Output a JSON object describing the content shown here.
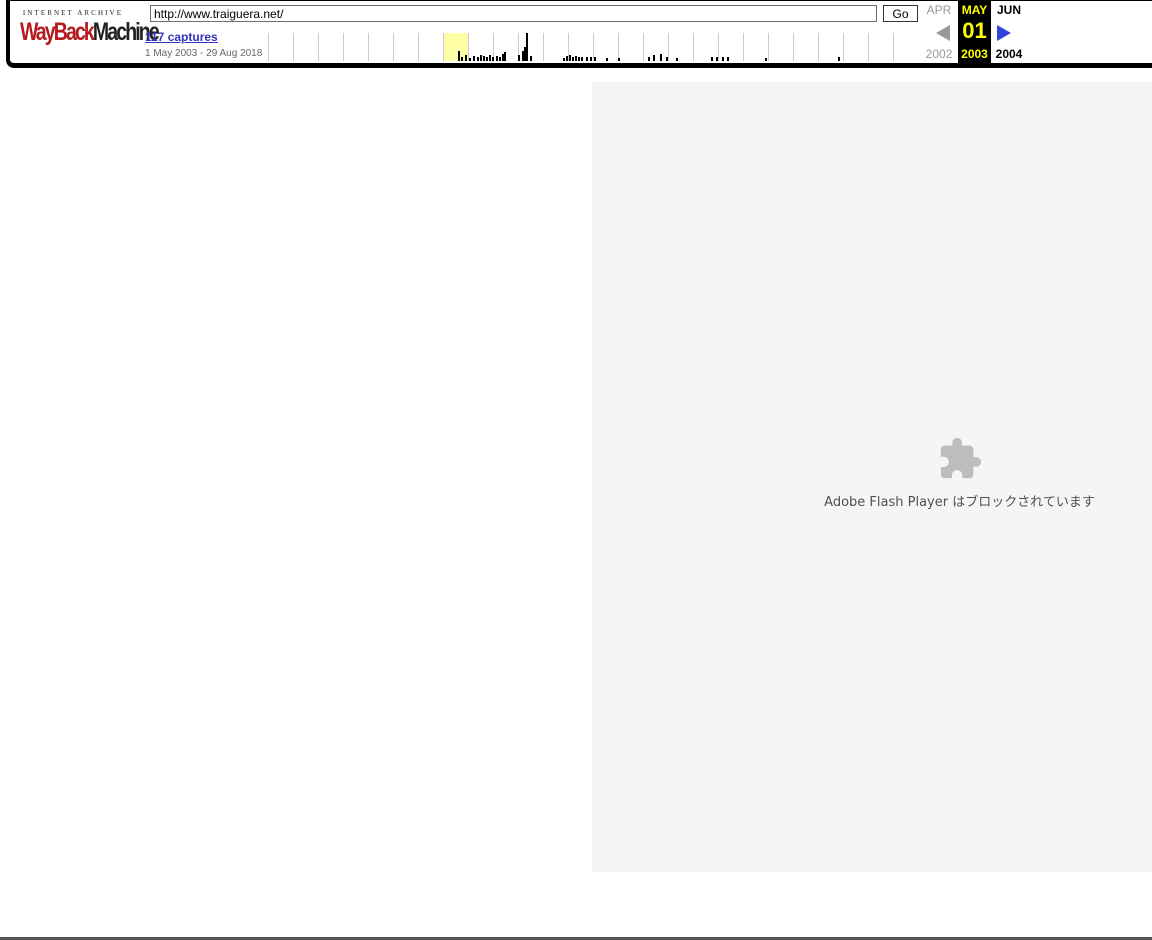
{
  "toolbar": {
    "logo_top": "INTERNET ARCHIVE",
    "logo_wayback": "WayBack",
    "logo_machine": "Machine",
    "url_value": "http://www.traiguera.net/",
    "go_label": "Go",
    "captures_label": "117 captures",
    "capture_range": "1 May 2003 - 29 Aug 2018"
  },
  "calendar": {
    "prev": {
      "month": "APR",
      "year": "2002"
    },
    "current": {
      "month": "MAY",
      "day": "01",
      "year": "2003"
    },
    "next": {
      "month": "JUN",
      "year": "2004"
    }
  },
  "flash": {
    "message": "Adobe Flash Player はブロックされています"
  },
  "colors": {
    "capture_link": "#3333bb",
    "current_date": "#ffff00",
    "next_arrow": "#3344dd",
    "placeholder_bg": "#f5f5f5"
  }
}
